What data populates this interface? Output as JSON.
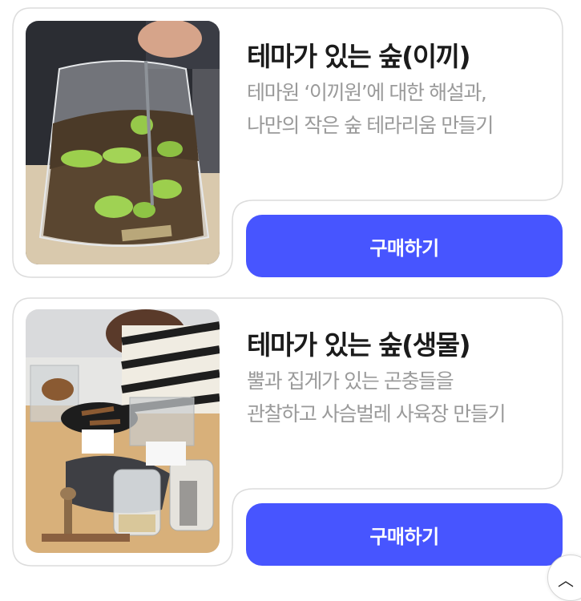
{
  "products": [
    {
      "title": "테마가 있는 숲(이끼)",
      "desc_line1": "테마원 ‘이끼원’에 대한 해설과,",
      "desc_line2": "나만의 작은 숲 테라리움 만들기",
      "button_label": "구매하기"
    },
    {
      "title": "테마가 있는 숲(생물)",
      "desc_line1": "뿔과 집게가 있는 곤충들을",
      "desc_line2": "관찰하고 사슴벌레 사육장 만들기",
      "button_label": "구매하기"
    }
  ],
  "scroll_top_icon": "chevron-up-icon",
  "colors": {
    "accent": "#4755ff",
    "title": "#1b1b1b",
    "description": "#9a9a9a",
    "card_border": "#dcdcdc"
  }
}
